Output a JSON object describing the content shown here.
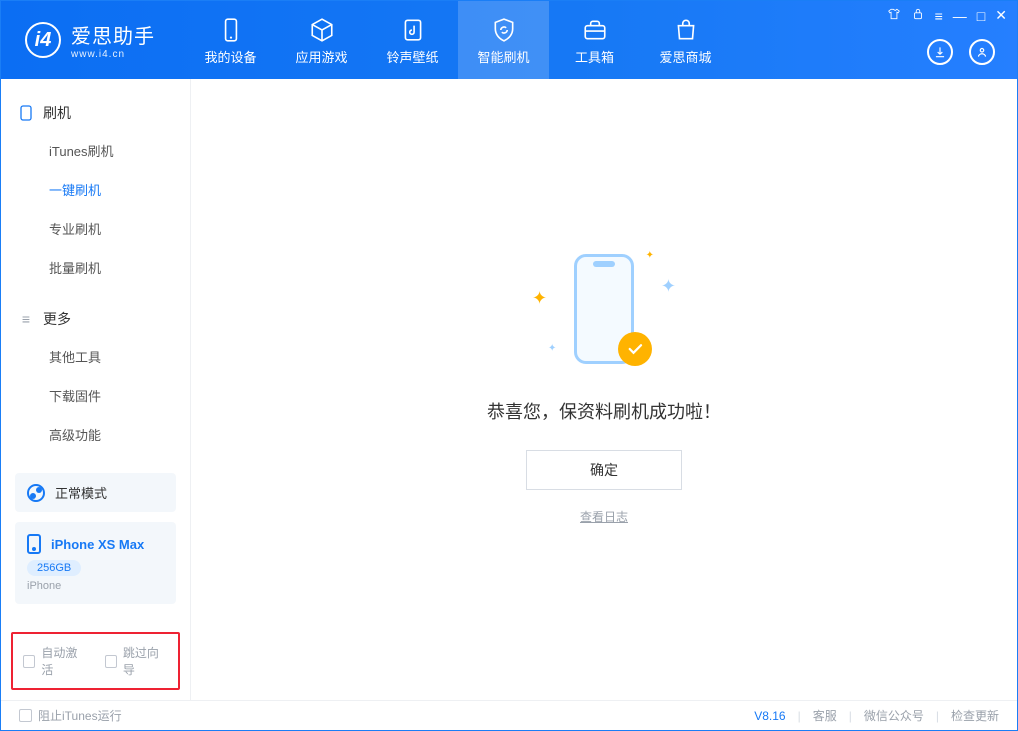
{
  "logo": {
    "title": "爱思助手",
    "url": "www.i4.cn"
  },
  "tabs": [
    {
      "label": "我的设备"
    },
    {
      "label": "应用游戏"
    },
    {
      "label": "铃声壁纸"
    },
    {
      "label": "智能刷机",
      "active": true
    },
    {
      "label": "工具箱"
    },
    {
      "label": "爱思商城"
    }
  ],
  "sidebar": {
    "section_flash": {
      "title": "刷机",
      "items": [
        "iTunes刷机",
        "一键刷机",
        "专业刷机",
        "批量刷机"
      ],
      "active_index": 1
    },
    "section_more": {
      "title": "更多",
      "items": [
        "其他工具",
        "下载固件",
        "高级功能"
      ]
    },
    "mode": {
      "label": "正常模式"
    },
    "device": {
      "name": "iPhone XS Max",
      "storage": "256GB",
      "type": "iPhone"
    },
    "bottom_checks": {
      "auto_activate": "自动激活",
      "skip_guide": "跳过向导"
    }
  },
  "main": {
    "success": "恭喜您，保资料刷机成功啦！",
    "confirm": "确定",
    "view_log": "查看日志"
  },
  "footer": {
    "block_itunes": "阻止iTunes运行",
    "version": "V8.16",
    "support": "客服",
    "wechat": "微信公众号",
    "update": "检查更新"
  }
}
